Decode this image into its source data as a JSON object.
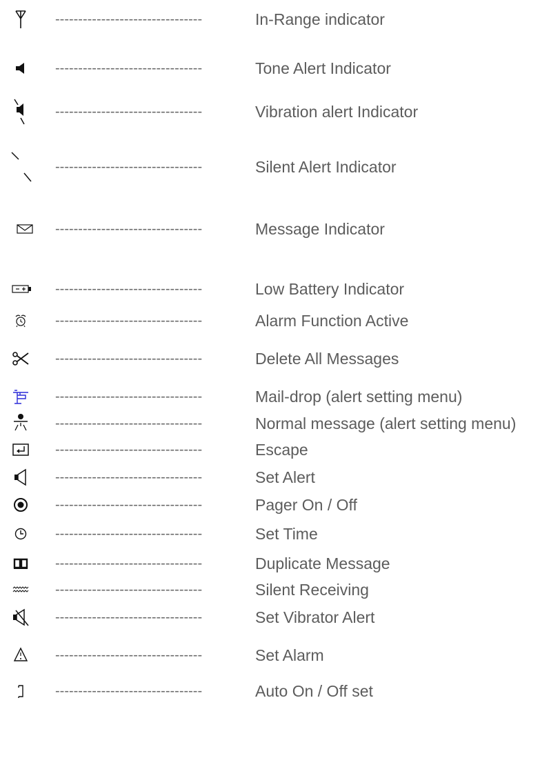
{
  "separator": "--------------------------------",
  "legend": [
    {
      "icon": "antenna-icon",
      "label": "In-Range indicator"
    },
    {
      "icon": "speaker-solid-icon",
      "label": "Tone Alert Indicator"
    },
    {
      "icon": "vibration-speaker-icon",
      "label": "Vibration alert Indicator"
    },
    {
      "icon": "silent-slash-icon",
      "label": "Silent Alert Indicator"
    },
    {
      "icon": "envelope-icon",
      "label": "Message Indicator"
    },
    {
      "icon": "battery-icon",
      "label": "Low Battery Indicator"
    },
    {
      "icon": "alarm-clock-icon",
      "label": "Alarm Function Active"
    },
    {
      "icon": "scissors-icon",
      "label": "Delete All Messages"
    },
    {
      "icon": "mail-drop-icon",
      "label": "Mail-drop (alert setting menu)"
    },
    {
      "icon": "normal-message-icon",
      "label": "Normal message (alert setting menu)"
    },
    {
      "icon": "escape-icon",
      "label": "Escape"
    },
    {
      "icon": "speaker-outline-icon",
      "label": "Set Alert"
    },
    {
      "icon": "power-ring-icon",
      "label": "Pager On / Off"
    },
    {
      "icon": "clock-icon",
      "label": "Set Time"
    },
    {
      "icon": "book-icon",
      "label": "Duplicate Message"
    },
    {
      "icon": "wave-icon",
      "label": "Silent Receiving"
    },
    {
      "icon": "speaker-muted-icon",
      "label": "Set Vibrator Alert"
    },
    {
      "icon": "bell-icon",
      "label": "Set Alarm"
    },
    {
      "icon": "bracket-icon",
      "label": "Auto On / Off set"
    }
  ]
}
